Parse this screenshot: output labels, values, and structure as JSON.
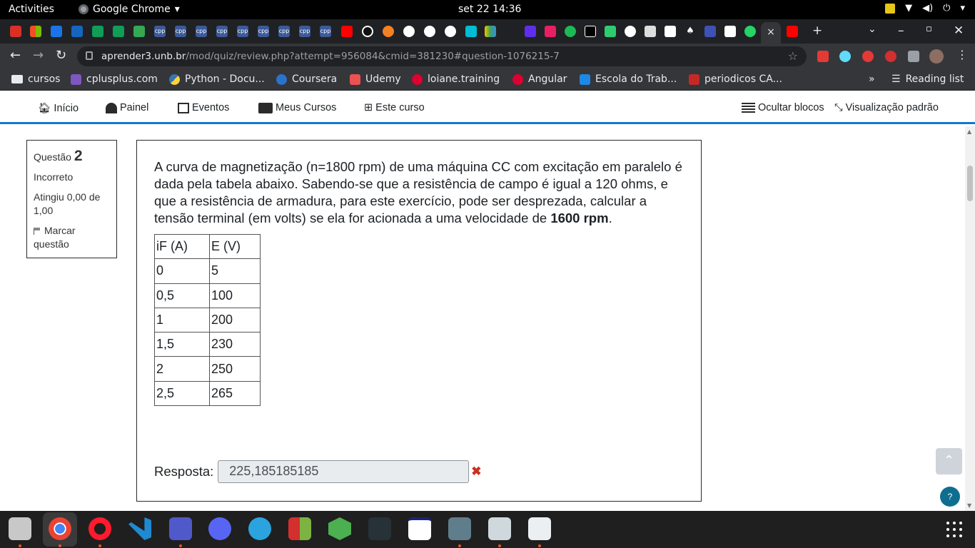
{
  "system_bar": {
    "activities": "Activities",
    "app_name": "Google Chrome",
    "clock": "set 22  14:36"
  },
  "tabs": {
    "active_close": "×",
    "new_tab": "+",
    "cpp_label": "cpp"
  },
  "browser": {
    "url_host": "aprender3.unb.br",
    "url_path": "/mod/quiz/review.php?attempt=956084&cmid=381230#question-1076215-7"
  },
  "bookmarks": {
    "items": [
      "cursos",
      "cplusplus.com",
      "Python - Docu...",
      "Coursera",
      "Udemy",
      "loiane.training",
      "Angular",
      "Escola do Trab...",
      "periodicos CA..."
    ],
    "more": "»",
    "reading_list": "Reading list"
  },
  "moodle_nav": {
    "inicio": "Início",
    "painel": "Painel",
    "eventos": "Eventos",
    "meus_cursos": "Meus Cursos",
    "este_curso": "Este curso",
    "ocultar_blocos": "Ocultar blocos",
    "visualizacao": "Visualização padrão"
  },
  "question_info": {
    "label": "Questão",
    "number": "2",
    "status": "Incorreto",
    "grade": "Atingiu 0,00 de 1,00",
    "flag": "Marcar questão"
  },
  "question": {
    "text_before": "A curva de magnetização (n=1800 rpm) de uma máquina CC com excitação em paralelo é dada pela tabela abaixo. Sabendo-se que a resistência de campo é igual a 120 ohms, e que a resistência de armadura, para este exercício, pode ser desprezada, calcular a tensão terminal (em volts) se ela for acionada a uma velocidade de ",
    "text_bold": "1600 rpm",
    "text_after": ".",
    "table": {
      "headers": [
        "iF (A)",
        "E (V)"
      ],
      "rows": [
        [
          "0",
          "5"
        ],
        [
          "0,5",
          "100"
        ],
        [
          "1",
          "200"
        ],
        [
          "1,5",
          "230"
        ],
        [
          "2",
          "250"
        ],
        [
          "2,5",
          "265"
        ]
      ]
    },
    "answer_label": "Resposta:",
    "answer_value": "225,185185185",
    "wrong_mark": "✖"
  },
  "floating": {
    "back_to_top": "⌃",
    "help": "?"
  }
}
